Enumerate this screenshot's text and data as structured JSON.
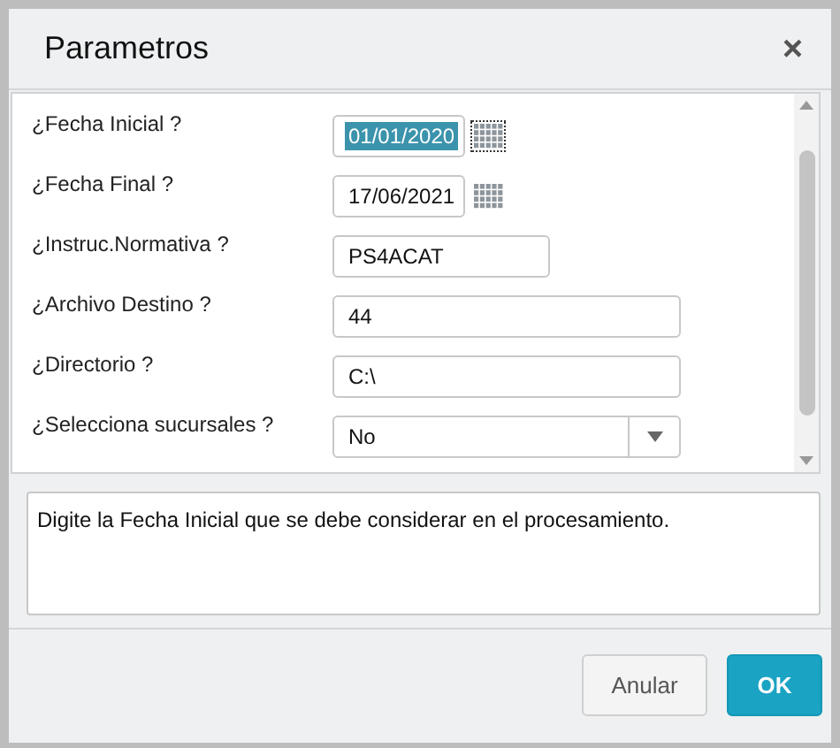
{
  "dialog": {
    "title": "Parametros",
    "close": "×"
  },
  "fields": [
    {
      "label": "¿Fecha Inicial ?",
      "kind": "date",
      "value": "01/01/2020",
      "highlighted": true
    },
    {
      "label": "¿Fecha Final ?",
      "kind": "date",
      "value": "17/06/2021",
      "highlighted": false
    },
    {
      "label": "¿Instruc.Normativa ?",
      "kind": "short",
      "value": "PS4ACAT",
      "highlighted": false
    },
    {
      "label": "¿Archivo Destino ?",
      "kind": "text",
      "value": "44",
      "highlighted": false
    },
    {
      "label": "¿Directorio ?",
      "kind": "text",
      "value": "C:\\",
      "highlighted": false
    },
    {
      "label": "¿Selecciona sucursales ?",
      "kind": "select",
      "value": "No",
      "highlighted": false
    }
  ],
  "help": "Digite la Fecha Inicial que se debe considerar en el procesamiento.",
  "buttons": [
    {
      "label": "Anular",
      "kind": "secondary"
    },
    {
      "label": "OK",
      "kind": "primary"
    }
  ]
}
